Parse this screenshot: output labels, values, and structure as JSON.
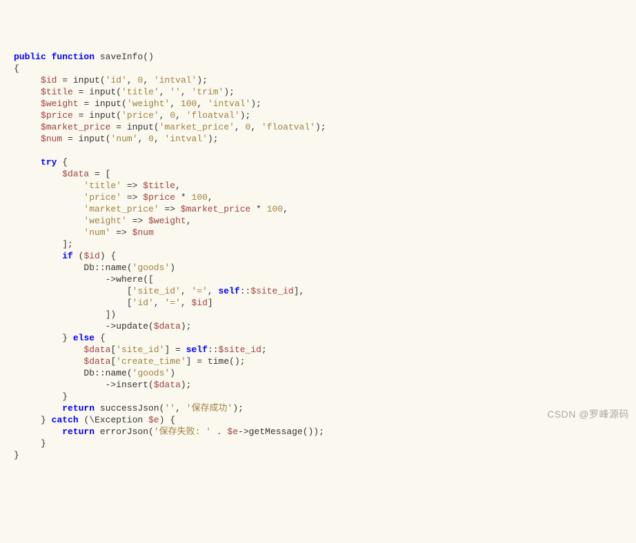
{
  "code": {
    "l1a": "public",
    "l1b": "function",
    "l1c": "saveInfo",
    "l2": "{",
    "l3a": "$id",
    "l3b": "=",
    "l3c": "input",
    "l3d": "'id'",
    "l3e": "0",
    "l3f": "'intval'",
    "l4a": "$title",
    "l4b": "=",
    "l4c": "input",
    "l4d": "'title'",
    "l4e": "''",
    "l4f": "'trim'",
    "l5a": "$weight",
    "l5b": "=",
    "l5c": "input",
    "l5d": "'weight'",
    "l5e": "100",
    "l5f": "'intval'",
    "l6a": "$price",
    "l6b": "=",
    "l6c": "input",
    "l6d": "'price'",
    "l6e": "0",
    "l6f": "'floatval'",
    "l7a": "$market_price",
    "l7b": "=",
    "l7c": "input",
    "l7d": "'market_price'",
    "l7e": "0",
    "l7f": "'floatval'",
    "l8a": "$num",
    "l8b": "=",
    "l8c": "input",
    "l8d": "'num'",
    "l8e": "0",
    "l8f": "'intval'",
    "l10a": "try",
    "l10b": "{",
    "l11a": "$data",
    "l11b": "=",
    "l11c": "[",
    "l12a": "'title'",
    "l12b": "=>",
    "l12c": "$title",
    "l13a": "'price'",
    "l13b": "=>",
    "l13c": "$price",
    "l13d": "*",
    "l13e": "100",
    "l14a": "'market_price'",
    "l14b": "=>",
    "l14c": "$market_price",
    "l14d": "*",
    "l14e": "100",
    "l15a": "'weight'",
    "l15b": "=>",
    "l15c": "$weight",
    "l16a": "'num'",
    "l16b": "=>",
    "l16c": "$num",
    "l17": "];",
    "l18a": "if",
    "l18b": "$id",
    "l19a": "Db",
    "l19b": "name",
    "l19c": "'goods'",
    "l20a": "->",
    "l20b": "where",
    "l20c": "([",
    "l21a": "[",
    "l21b": "'site_id'",
    "l21c": "'='",
    "l21d": "self",
    "l21e": "$site_id",
    "l21f": "],",
    "l22a": "[",
    "l22b": "'id'",
    "l22c": "'='",
    "l22d": "$id",
    "l22e": "]",
    "l23": "])",
    "l24a": "->",
    "l24b": "update",
    "l24c": "$data",
    "l25a": "}",
    "l25b": "else",
    "l25c": "{",
    "l26a": "$data",
    "l26b": "[",
    "l26c": "'site_id'",
    "l26d": "]",
    "l26e": "=",
    "l26f": "self",
    "l26g": "$site_id",
    "l27a": "$data",
    "l27b": "[",
    "l27c": "'create_time'",
    "l27d": "]",
    "l27e": "=",
    "l27f": "time",
    "l28a": "Db",
    "l28b": "name",
    "l28c": "'goods'",
    "l29a": "->",
    "l29b": "insert",
    "l29c": "$data",
    "l30": "}",
    "l31a": "return",
    "l31b": "successJson",
    "l31c": "''",
    "l31d": "'保存成功'",
    "l32a": "}",
    "l32b": "catch",
    "l32c": "\\Exception",
    "l32d": "$e",
    "l33a": "return",
    "l33b": "errorJson",
    "l33c": "'保存失败: '",
    "l33d": "$e",
    "l33e": "->",
    "l33f": "getMessage",
    "l34": "}"
  },
  "watermark": "CSDN @罗峰源码"
}
